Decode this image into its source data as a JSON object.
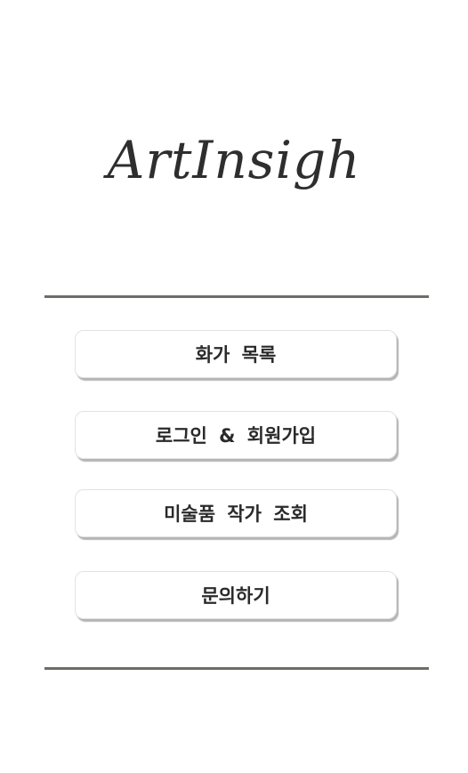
{
  "app": {
    "logo_text": "ArtInsigh"
  },
  "menu": {
    "items": [
      {
        "label": "화가 목록"
      },
      {
        "label": "로그인 & 회원가입"
      },
      {
        "label": "미술품 작가 조회"
      },
      {
        "label": "문의하기"
      }
    ]
  },
  "colors": {
    "divider": "#6f6c67",
    "text": "#2a2a2a",
    "button_shadow": "#b5b5b5"
  }
}
